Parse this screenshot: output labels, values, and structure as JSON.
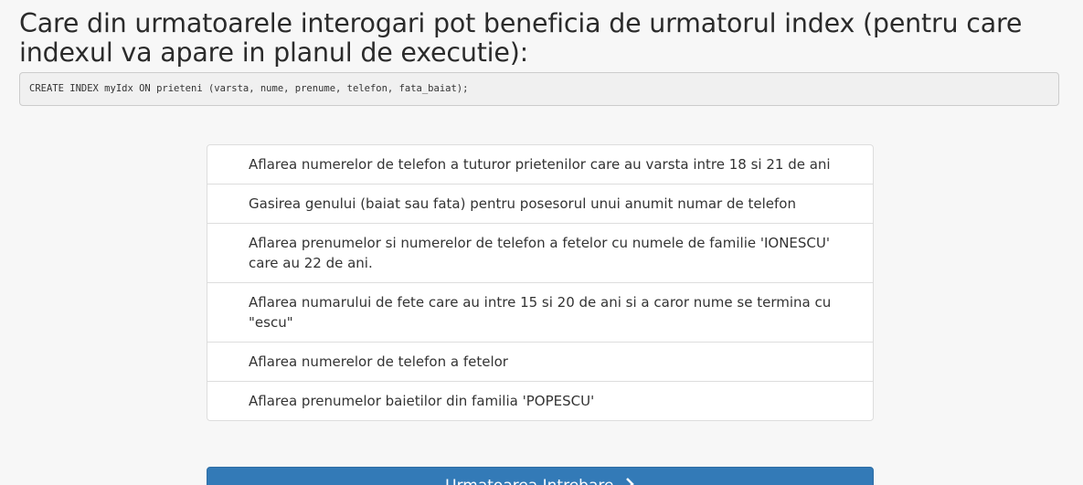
{
  "question": {
    "title": "Care din urmatoarele interogari pot beneficia de urmatorul index (pentru care indexul va apare in planul de executie):",
    "code": "CREATE INDEX myIdx ON prieteni (varsta, nume, prenume, telefon, fata_baiat);"
  },
  "answers": [
    "Aflarea numerelor de telefon a tuturor prietenilor care au varsta intre 18 si 21 de ani",
    "Gasirea genului (baiat sau fata) pentru posesorul unui anumit numar de telefon",
    "Aflarea prenumelor si numerelor de telefon a fetelor cu numele de familie 'IONESCU' care au 22 de ani.",
    "Aflarea numarului de fete care au intre 15 si 20 de ani si a caror nume se termina cu \"escu\"",
    "Aflarea numerelor de telefon a fetelor",
    "Aflarea prenumelor baietilor din familia 'POPESCU'"
  ],
  "next_button": {
    "label": "Urmatoarea Intrebare",
    "icon": "chevron-right-icon"
  },
  "colors": {
    "background": "#f7f7f7",
    "button": "#337ab7",
    "border": "#dddddd"
  }
}
